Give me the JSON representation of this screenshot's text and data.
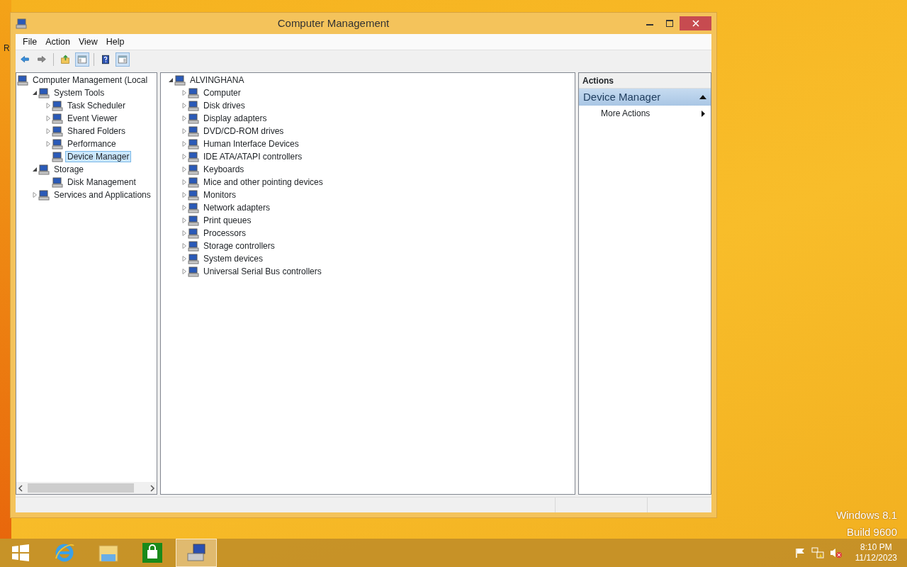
{
  "desktop": {
    "edge_label": "R",
    "watermark": [
      "Windows 8.1",
      "Build 9600"
    ]
  },
  "window": {
    "title": "Computer Management",
    "menu": [
      "File",
      "Action",
      "View",
      "Help"
    ],
    "toolbar": [
      {
        "kind": "back",
        "pressed": false
      },
      {
        "kind": "forward",
        "pressed": false
      },
      {
        "kind": "up",
        "pressed": false
      },
      {
        "kind": "tree-pane",
        "pressed": true
      },
      {
        "kind": "help",
        "pressed": false
      },
      {
        "kind": "action-pane",
        "pressed": true
      }
    ],
    "console_tree": [
      {
        "label": "Computer Management (Local",
        "selected": false,
        "children": [
          {
            "label": "System Tools",
            "expanded": true,
            "selected": false,
            "children": [
              {
                "label": "Task Scheduler",
                "expanded": false,
                "selected": false
              },
              {
                "label": "Event Viewer",
                "expanded": false,
                "selected": false
              },
              {
                "label": "Shared Folders",
                "expanded": false,
                "selected": false
              },
              {
                "label": "Performance",
                "expanded": false,
                "selected": false
              },
              {
                "label": "Device Manager",
                "selected": true
              }
            ]
          },
          {
            "label": "Storage",
            "expanded": true,
            "selected": false,
            "children": [
              {
                "label": "Disk Management",
                "selected": false
              }
            ]
          },
          {
            "label": "Services and Applications",
            "expanded": false,
            "selected": false
          }
        ]
      }
    ],
    "device_tree": [
      {
        "label": "ALVINGHANA",
        "expanded": true,
        "children": [
          {
            "label": "Computer",
            "expanded": false
          },
          {
            "label": "Disk drives",
            "expanded": false
          },
          {
            "label": "Display adapters",
            "expanded": false
          },
          {
            "label": "DVD/CD-ROM drives",
            "expanded": false
          },
          {
            "label": "Human Interface Devices",
            "expanded": false
          },
          {
            "label": "IDE ATA/ATAPI controllers",
            "expanded": false
          },
          {
            "label": "Keyboards",
            "expanded": false
          },
          {
            "label": "Mice and other pointing devices",
            "expanded": false
          },
          {
            "label": "Monitors",
            "expanded": false
          },
          {
            "label": "Network adapters",
            "expanded": false
          },
          {
            "label": "Print queues",
            "expanded": false
          },
          {
            "label": "Processors",
            "expanded": false
          },
          {
            "label": "Storage controllers",
            "expanded": false
          },
          {
            "label": "System devices",
            "expanded": false
          },
          {
            "label": "Universal Serial Bus controllers",
            "expanded": false
          }
        ]
      }
    ],
    "actions": {
      "header": "Actions",
      "section": {
        "label": "Device Manager",
        "expanded": true
      },
      "items": [
        "More Actions"
      ]
    }
  },
  "taskbar": {
    "apps": [
      {
        "kind": "start",
        "selected": false
      },
      {
        "kind": "browser",
        "selected": false
      },
      {
        "kind": "folder",
        "selected": false
      },
      {
        "kind": "store",
        "selected": false
      },
      {
        "kind": "console",
        "selected": true
      }
    ],
    "tray": {
      "time": "8:10 PM",
      "date": "11/12/2023"
    }
  }
}
